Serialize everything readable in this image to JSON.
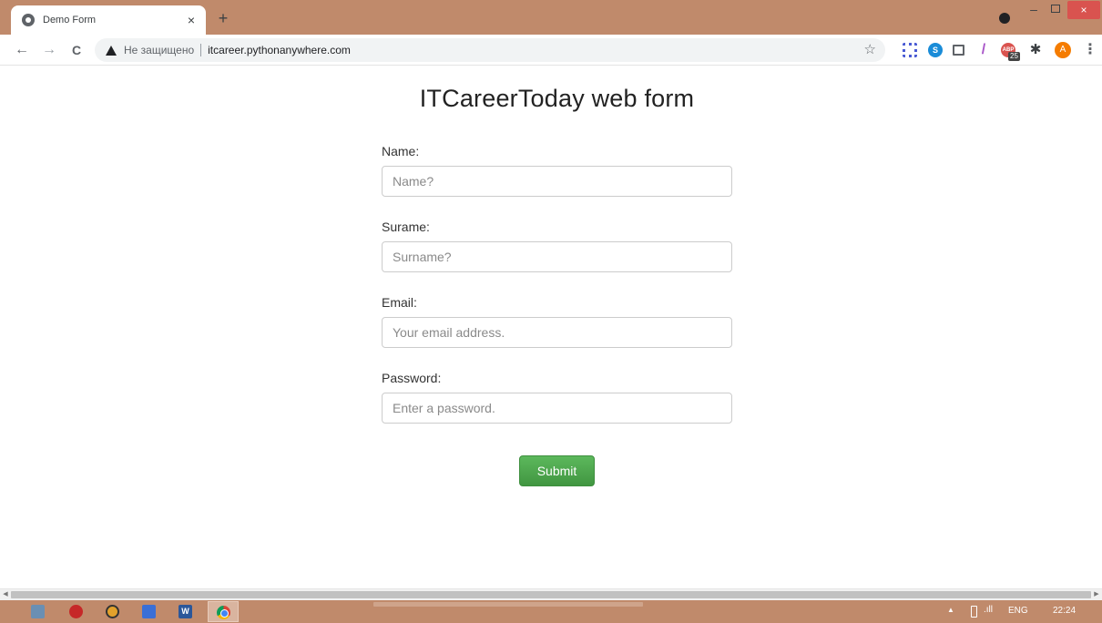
{
  "browser": {
    "tab": {
      "title": "Demo Form",
      "close_glyph": "×"
    },
    "new_tab_glyph": "+",
    "window_controls": {
      "minimize_glyph": "–",
      "close_glyph": "×"
    },
    "nav": {
      "back_glyph": "←",
      "forward_glyph": "→",
      "reload_glyph": "C"
    },
    "omnibox": {
      "security_label": "Не защищено",
      "url": "itcareer.pythonanywhere.com",
      "bookmark_glyph": "☆"
    },
    "extensions": {
      "skype_glyph": "S",
      "pen_glyph": "/",
      "abp_glyph": "ABP",
      "abp_badge": "25",
      "puzzle_glyph": "✱"
    },
    "profile_initial": "A",
    "menu_glyph": "⋮"
  },
  "page": {
    "title": "ITCareerToday web form",
    "fields": {
      "name": {
        "label": "Name:",
        "placeholder": "Name?",
        "value": ""
      },
      "surname": {
        "label": "Surame:",
        "placeholder": "Surname?",
        "value": ""
      },
      "email": {
        "label": "Email:",
        "placeholder": "Your email address.",
        "value": ""
      },
      "password": {
        "label": "Password:",
        "placeholder": "Enter a password.",
        "value": ""
      }
    },
    "submit_label": "Submit"
  },
  "taskbar": {
    "word_glyph": "W",
    "tray": {
      "up_glyph": "▲",
      "signal_glyph": ".ıll",
      "language": "ENG",
      "time": "22:24"
    }
  },
  "scrollbar": {
    "left_glyph": "◀",
    "right_glyph": "▶"
  },
  "colors": {
    "chrome_frame": "#c08a6b",
    "submit_green": "#5cb85c",
    "taskbar": "#c08a6b"
  }
}
